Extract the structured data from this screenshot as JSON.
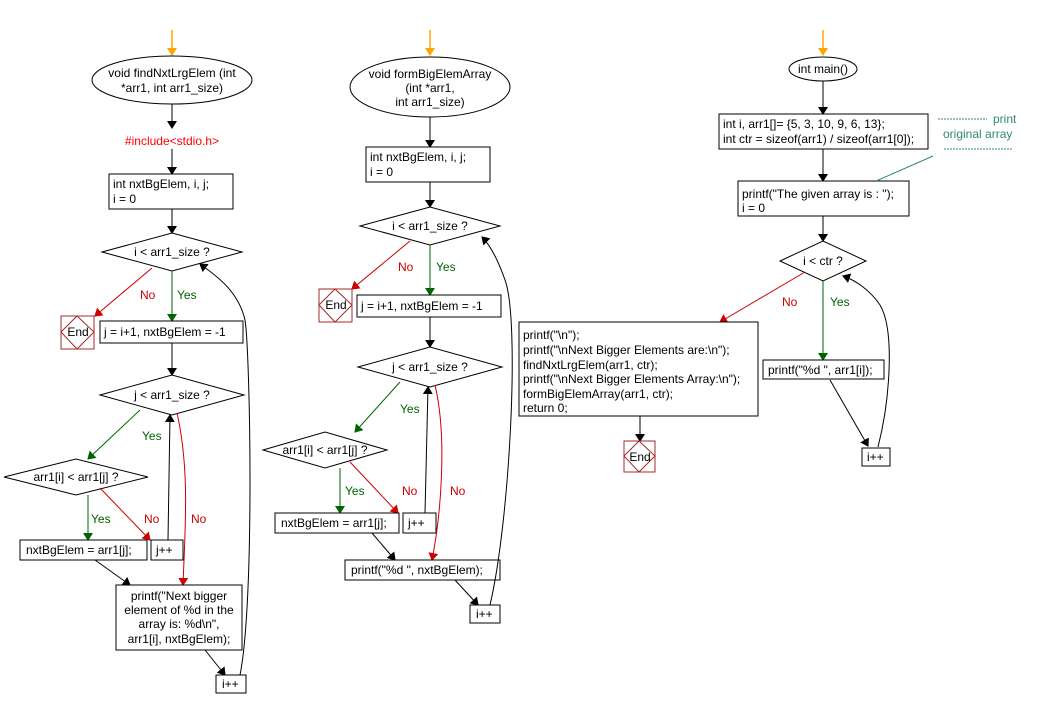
{
  "colors": {
    "yes": "#006400",
    "no": "#cc0000",
    "start_arrow": "#ffa500",
    "include": "#ff0000",
    "end_border": "#a52a2a",
    "comment": "#2e8b6b"
  },
  "labels": {
    "yes": "Yes",
    "no": "No",
    "end": "End"
  },
  "find": {
    "start": [
      "void findNxtLrgElem (int",
      "*arr1, int arr1_size)"
    ],
    "include": "#include<stdio.h>",
    "init": [
      "int nxtBgElem, i, j;",
      "i = 0"
    ],
    "cond_i": "i < arr1_size ?",
    "set_j": "j = i+1, nxtBgElem = -1",
    "cond_j": "j < arr1_size ?",
    "cond_cmp": "arr1[i] < arr1[j] ?",
    "assign": "nxtBgElem = arr1[j];",
    "j_inc": "j++",
    "print": [
      "printf(\"Next bigger",
      "element of %d in the",
      "array is:   %d\\n\",",
      "arr1[i], nxtBgElem);"
    ],
    "i_inc": "i++"
  },
  "form": {
    "start": [
      "void formBigElemArray",
      "(int *arr1,",
      "int arr1_size)"
    ],
    "init": [
      "int nxtBgElem, i, j;",
      "i = 0"
    ],
    "cond_i": "i < arr1_size ?",
    "set_j": "j = i+1, nxtBgElem = -1",
    "cond_j": "j < arr1_size ?",
    "cond_cmp": "arr1[i] < arr1[j] ?",
    "assign": "nxtBgElem = arr1[j];",
    "j_inc": "j++",
    "print": "printf(\"%d \", nxtBgElem);",
    "i_inc": "i++"
  },
  "main": {
    "start": "int main()",
    "decl": [
      "int i, arr1[]= {5, 3, 10, 9, 6, 13};",
      "int ctr = sizeof(arr1) / sizeof(arr1[0]);"
    ],
    "print_init": [
      "printf(\"The given array is :  \");",
      "i = 0"
    ],
    "cond": "i < ctr ?",
    "body": [
      "printf(\"\\n\");",
      "printf(\"\\nNext Bigger Elements are:\\n\");",
      "findNxtLrgElem(arr1, ctr);",
      "printf(\"\\nNext Bigger Elements Array:\\n\");",
      "formBigElemArray(arr1, ctr);",
      "return 0;"
    ],
    "print_elem": "printf(\"%d  \", arr1[i]);",
    "i_inc": "i++",
    "comment": [
      "print",
      "original array"
    ]
  }
}
